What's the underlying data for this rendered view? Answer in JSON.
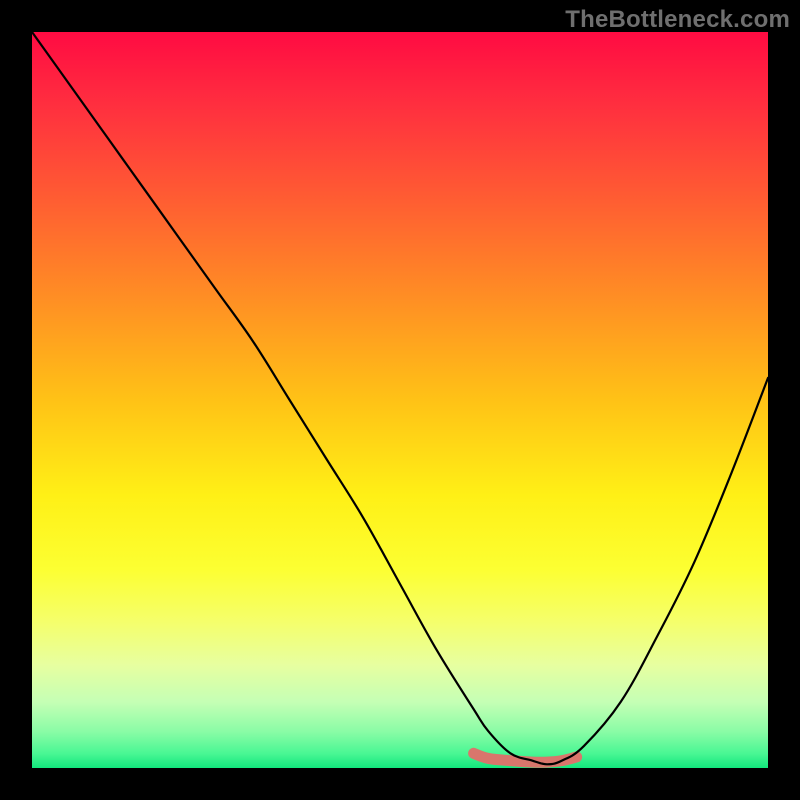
{
  "watermark": "TheBottleneck.com",
  "chart_data": {
    "type": "line",
    "title": "",
    "xlabel": "",
    "ylabel": "",
    "xlim": [
      0,
      100
    ],
    "ylim": [
      0,
      100
    ],
    "grid": false,
    "series": [
      {
        "name": "curve",
        "x": [
          0,
          5,
          10,
          15,
          20,
          25,
          30,
          35,
          40,
          45,
          50,
          55,
          60,
          62,
          65,
          68,
          70,
          72,
          75,
          80,
          85,
          90,
          95,
          100
        ],
        "values": [
          100,
          93,
          86,
          79,
          72,
          65,
          58,
          50,
          42,
          34,
          25,
          16,
          8,
          5,
          2,
          1,
          0.5,
          1,
          3,
          9,
          18,
          28,
          40,
          53
        ],
        "color": "#000000"
      },
      {
        "name": "highlight-band",
        "x": [
          60,
          62,
          65,
          68,
          70,
          72,
          74
        ],
        "values": [
          2.0,
          1.3,
          1.0,
          0.8,
          0.8,
          1.0,
          1.5
        ],
        "color": "#d9766c"
      }
    ],
    "annotations": []
  }
}
